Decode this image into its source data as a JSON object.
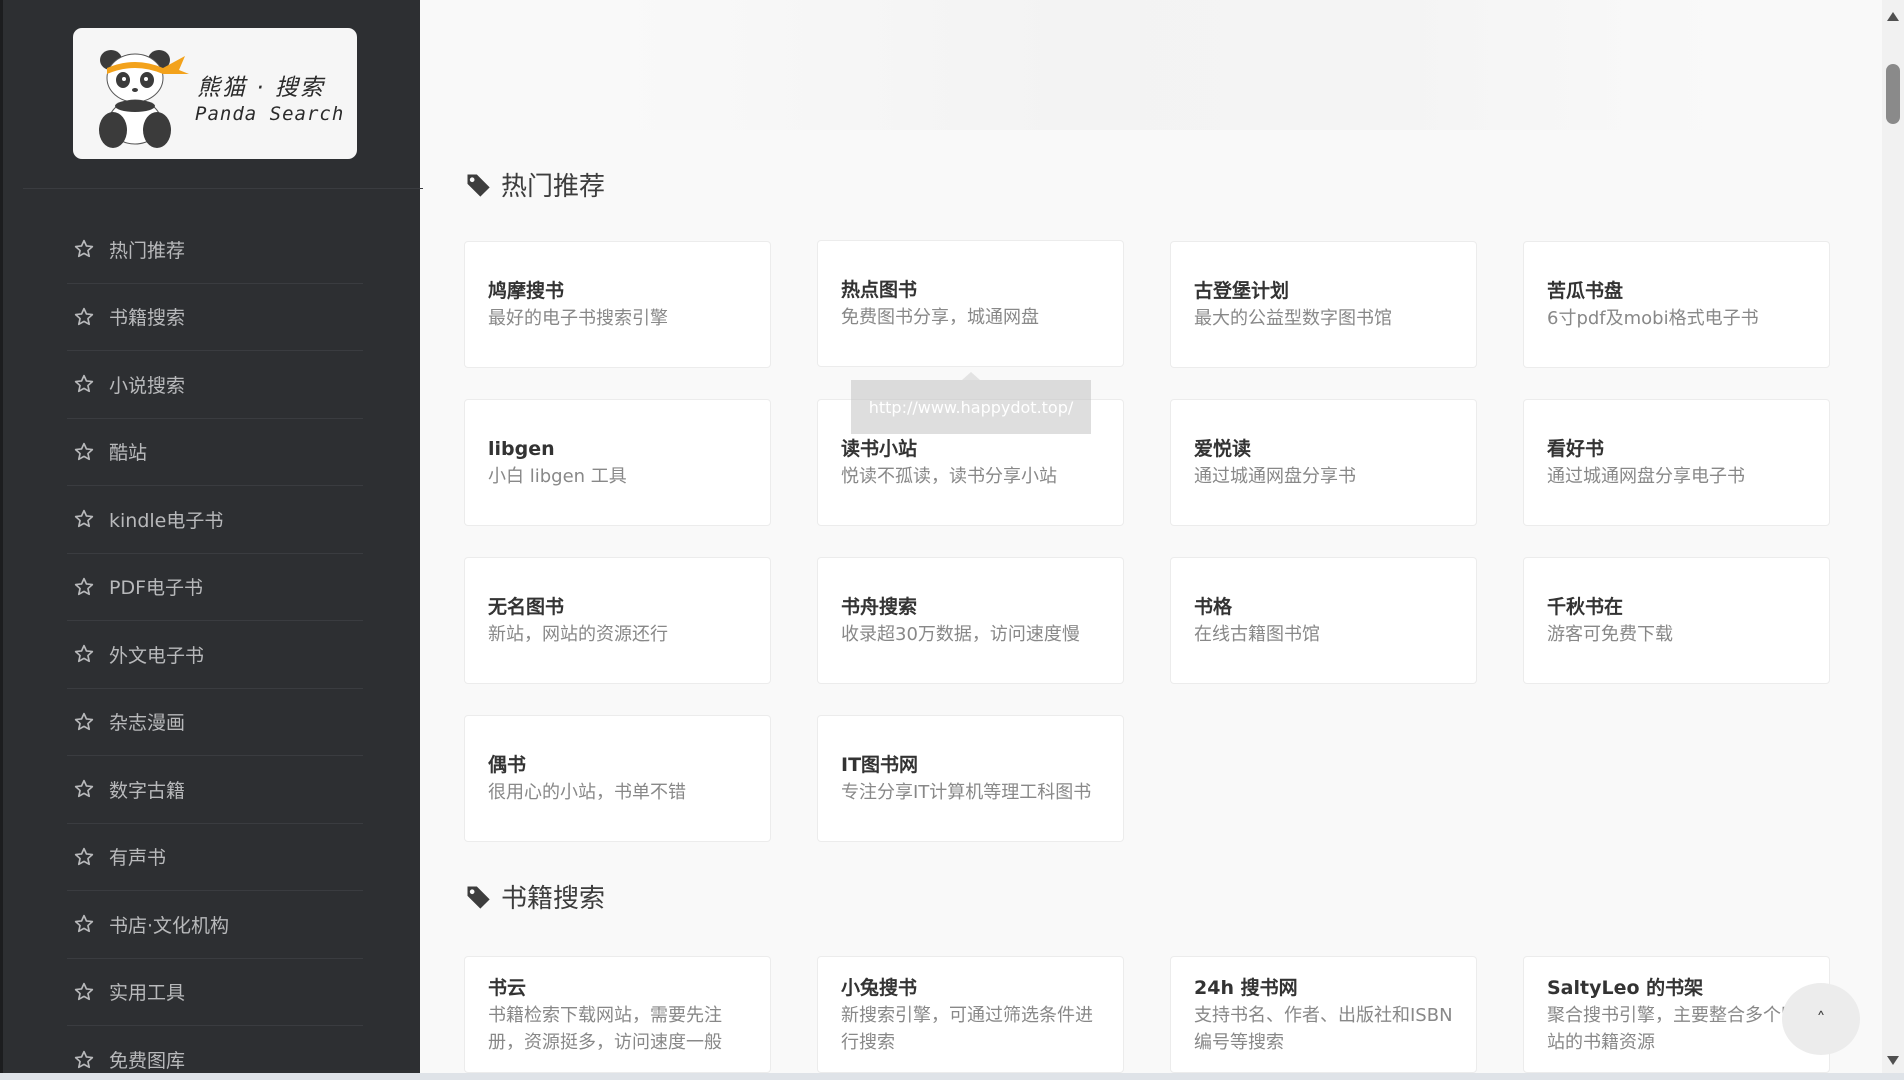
{
  "brand": {
    "name_cn": "熊猫 · 搜索",
    "name_en": "Panda Search"
  },
  "sidebar": {
    "items": [
      {
        "label": "热门推荐"
      },
      {
        "label": "书籍搜索"
      },
      {
        "label": "小说搜索"
      },
      {
        "label": "酷站"
      },
      {
        "label": "kindle电子书"
      },
      {
        "label": "PDF电子书"
      },
      {
        "label": "外文电子书"
      },
      {
        "label": "杂志漫画"
      },
      {
        "label": "数字古籍"
      },
      {
        "label": "有声书"
      },
      {
        "label": "书店·文化机构"
      },
      {
        "label": "实用工具"
      },
      {
        "label": "免费图库"
      }
    ]
  },
  "sections": [
    {
      "title": "热门推荐",
      "cards": [
        {
          "title": "鸠摩搜书",
          "desc": "最好的电子书搜索引擎"
        },
        {
          "title": "热点图书",
          "desc": "免费图书分享，城通网盘"
        },
        {
          "title": "古登堡计划",
          "desc": "最大的公益型数字图书馆"
        },
        {
          "title": "苦瓜书盘",
          "desc": "6寸pdf及mobi格式电子书"
        },
        {
          "title": "libgen",
          "desc": "小白 libgen 工具"
        },
        {
          "title": "读书小站",
          "desc": "悦读不孤读，读书分享小站"
        },
        {
          "title": "爱悦读",
          "desc": "通过城通网盘分享书"
        },
        {
          "title": "看好书",
          "desc": "通过城通网盘分享电子书"
        },
        {
          "title": "无名图书",
          "desc": "新站，网站的资源还行"
        },
        {
          "title": "书舟搜索",
          "desc": "收录超30万数据，访问速度慢"
        },
        {
          "title": "书格",
          "desc": "在线古籍图书馆"
        },
        {
          "title": "千秋书在",
          "desc": "游客可免费下载"
        },
        {
          "title": "偶书",
          "desc": "很用心的小站，书单不错"
        },
        {
          "title": "IT图书网",
          "desc": "专注分享IT计算机等理工科图书"
        }
      ]
    },
    {
      "title": "书籍搜索",
      "cards": [
        {
          "title": "书云",
          "desc": "书籍检索下载网站，需要先注册，资源挺多，访问速度一般"
        },
        {
          "title": "小兔搜书",
          "desc": "新搜索引擎，可通过筛选条件进行搜索"
        },
        {
          "title": "24h 搜书网",
          "desc": "支持书名、作者、出版社和ISBN编号等搜索"
        },
        {
          "title": "SaltyLeo 的书架",
          "desc": "聚合搜书引擎，主要整合多个网站的书籍资源"
        }
      ]
    }
  ],
  "tooltip": {
    "text": "http://www.happydot.top/"
  },
  "back_to_top": {
    "icon": "chevron-up-icon",
    "glyph": "˄"
  },
  "colors": {
    "sidebar_bg": "#2d2f32",
    "main_bg": "#f9f9f9",
    "card_bg": "#ffffff",
    "sidebar_text": "#b8b9bb"
  }
}
